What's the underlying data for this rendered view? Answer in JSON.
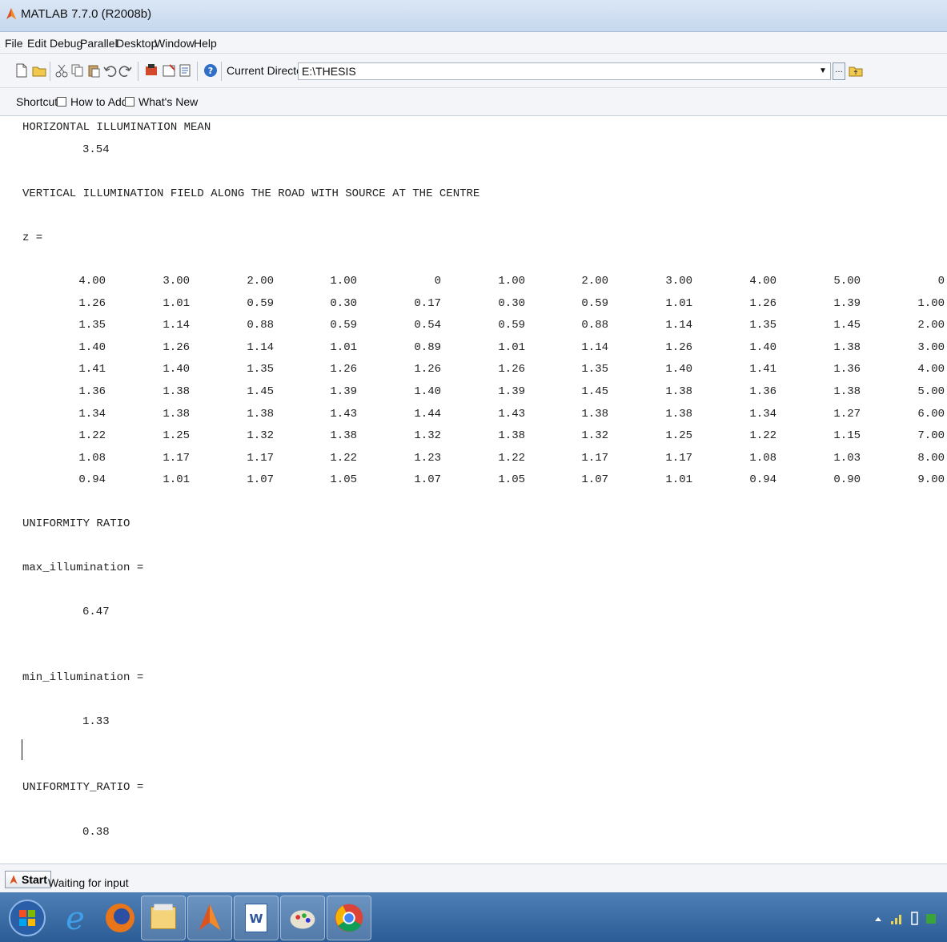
{
  "window": {
    "title": "MATLAB 7.7.0 (R2008b)"
  },
  "menu": [
    "File",
    "Edit",
    "Debug",
    "Parallel",
    "Desktop",
    "Window",
    "Help"
  ],
  "toolbar": {
    "current_directory_label": "Current Directory:",
    "current_directory_value": "E:\\THESIS"
  },
  "shortcuts": {
    "label": "Shortcuts",
    "items": [
      "How to Add",
      "What's New"
    ]
  },
  "console": {
    "horizontal_mean_heading": "HORIZONTAL ILLUMINATION MEAN",
    "horizontal_mean_value": "3.54",
    "vertical_field_heading": "VERTICAL ILLUMINATION FIELD ALONG THE ROAD WITH SOURCE AT THE CENTRE",
    "z_assign": "z =",
    "z_rows": [
      [
        "4.00",
        "3.00",
        "2.00",
        "1.00",
        "0",
        "1.00",
        "2.00",
        "3.00",
        "4.00",
        "5.00",
        "0"
      ],
      [
        "1.26",
        "1.01",
        "0.59",
        "0.30",
        "0.17",
        "0.30",
        "0.59",
        "1.01",
        "1.26",
        "1.39",
        "1.00"
      ],
      [
        "1.35",
        "1.14",
        "0.88",
        "0.59",
        "0.54",
        "0.59",
        "0.88",
        "1.14",
        "1.35",
        "1.45",
        "2.00"
      ],
      [
        "1.40",
        "1.26",
        "1.14",
        "1.01",
        "0.89",
        "1.01",
        "1.14",
        "1.26",
        "1.40",
        "1.38",
        "3.00"
      ],
      [
        "1.41",
        "1.40",
        "1.35",
        "1.26",
        "1.26",
        "1.26",
        "1.35",
        "1.40",
        "1.41",
        "1.36",
        "4.00"
      ],
      [
        "1.36",
        "1.38",
        "1.45",
        "1.39",
        "1.40",
        "1.39",
        "1.45",
        "1.38",
        "1.36",
        "1.38",
        "5.00"
      ],
      [
        "1.34",
        "1.38",
        "1.38",
        "1.43",
        "1.44",
        "1.43",
        "1.38",
        "1.38",
        "1.34",
        "1.27",
        "6.00"
      ],
      [
        "1.22",
        "1.25",
        "1.32",
        "1.38",
        "1.32",
        "1.38",
        "1.32",
        "1.25",
        "1.22",
        "1.15",
        "7.00"
      ],
      [
        "1.08",
        "1.17",
        "1.17",
        "1.22",
        "1.23",
        "1.22",
        "1.17",
        "1.17",
        "1.08",
        "1.03",
        "8.00"
      ],
      [
        "0.94",
        "1.01",
        "1.07",
        "1.05",
        "1.07",
        "1.05",
        "1.07",
        "1.01",
        "0.94",
        "0.90",
        "9.00"
      ]
    ],
    "uniformity_heading": "UNIFORMITY RATIO",
    "max_assign": "max_illumination =",
    "max_value": "6.47",
    "min_assign": "min_illumination =",
    "min_value": "1.33",
    "ratio_assign": "UNIFORMITY_RATIO =",
    "ratio_value": "0.38"
  },
  "statusbar": {
    "start_label": "Start",
    "status": "Waiting for input"
  },
  "taskbar": {
    "apps": [
      "windows-start-orb-icon",
      "internet-explorer-icon",
      "firefox-icon",
      "file-explorer-icon",
      "matlab-icon",
      "word-icon",
      "paint-icon",
      "chrome-icon"
    ]
  }
}
